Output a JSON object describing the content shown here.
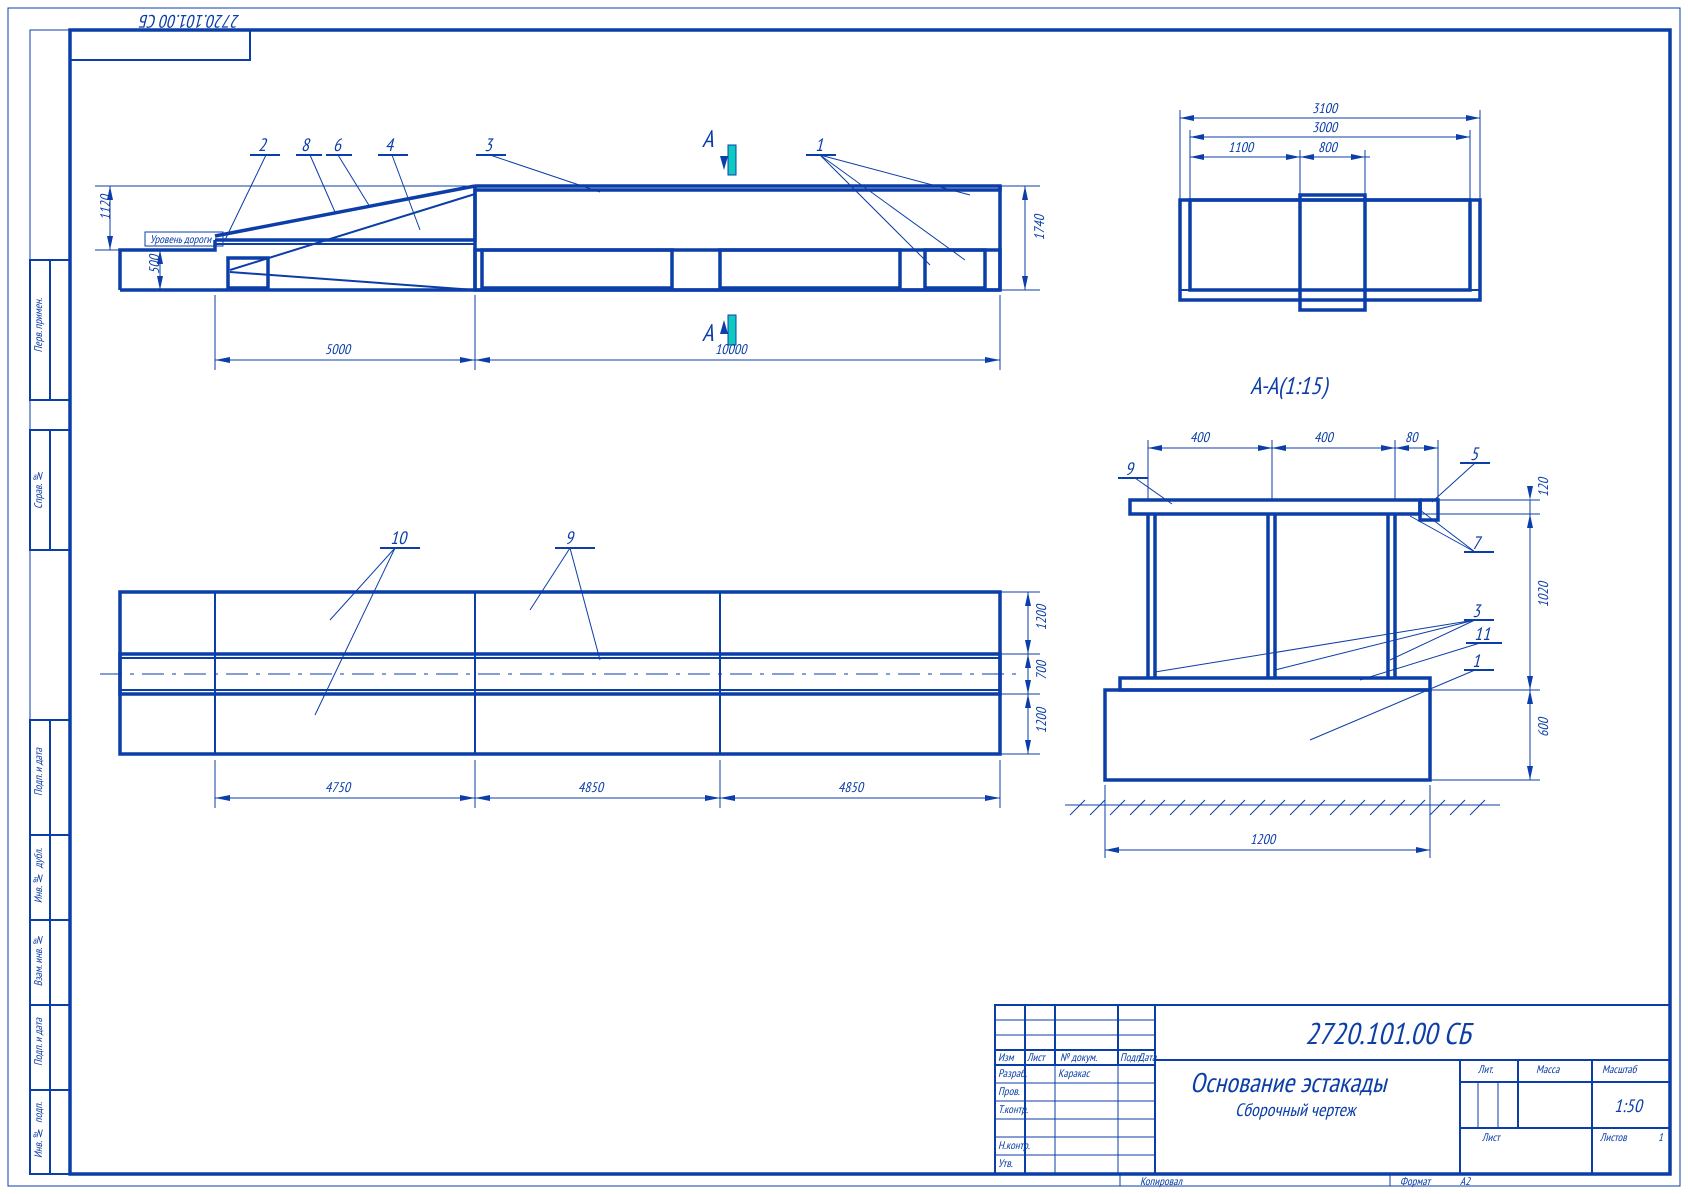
{
  "drawingNumber": "2720.101.00 СБ",
  "title": "Основание эстакады",
  "subtitle": "Сборочный чертеж",
  "sectionLabel": "А-А(1:15)",
  "sectionMarkTop": "А",
  "sectionMarkBottom": "А",
  "roadLevelNote": "Уровень дороги",
  "dims": {
    "side_h1": "1120",
    "side_h2": "500",
    "side_h3": "1740",
    "side_L1": "5000",
    "side_L2": "10000",
    "top_w_outer1": "1200",
    "top_w_mid": "700",
    "top_w_outer2": "1200",
    "top_L1": "4750",
    "top_L2": "4850",
    "top_L3": "4850",
    "end_w_full": "3100",
    "end_w_inner": "3000",
    "end_off": "1100",
    "end_gap": "800",
    "sec_a": "400",
    "sec_b": "400",
    "sec_c": "80",
    "sec_t": "120",
    "sec_h": "1020",
    "sec_foot_h": "600",
    "sec_foot_w": "1200"
  },
  "balloons": {
    "b1": "1",
    "b2": "2",
    "b3": "3",
    "b4": "4",
    "b5": "5",
    "b6": "6",
    "b7": "7",
    "b8": "8",
    "b9": "9",
    "b10": "10",
    "b11": "11"
  },
  "titleBlock": {
    "rows": [
      "Изм",
      "Лист",
      "№ докум.",
      "Подп.",
      "Дата"
    ],
    "roles": [
      "Разраб.",
      "Пров.",
      "Т.контр.",
      "",
      "Н.контр.",
      "Утв."
    ],
    "author": "Каракас",
    "litLabel": "Лит.",
    "massLabel": "Масса",
    "scaleLabel": "Масштаб",
    "scale": "1:50",
    "sheetLabel": "Лист",
    "sheetsLabel": "Листов",
    "sheetsVal": "1",
    "formatLabel": "Формат",
    "formatVal": "А2",
    "copyLabel": "Копировал"
  },
  "sideCells": [
    "Перв. примен.",
    "Справ. №",
    "Подп. и дата",
    "Инв. № дубл.",
    "Взам. инв. №",
    "Подп. и дата",
    "Инв. № подп."
  ]
}
